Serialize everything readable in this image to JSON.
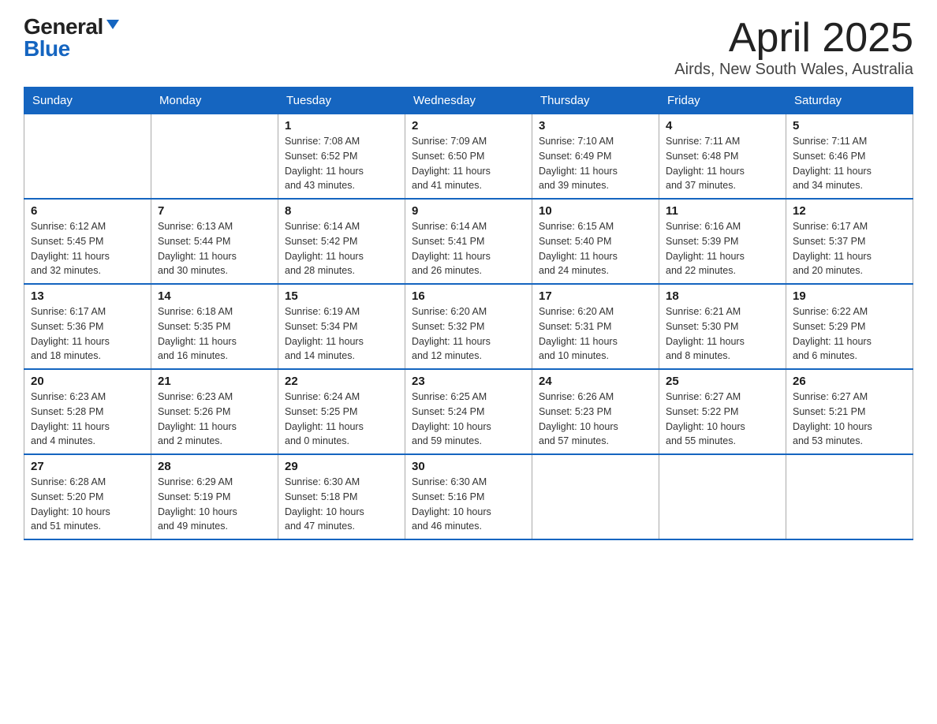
{
  "logo": {
    "general": "General",
    "blue": "Blue"
  },
  "title": "April 2025",
  "subtitle": "Airds, New South Wales, Australia",
  "weekdays": [
    "Sunday",
    "Monday",
    "Tuesday",
    "Wednesday",
    "Thursday",
    "Friday",
    "Saturday"
  ],
  "weeks": [
    [
      {
        "day": "",
        "info": ""
      },
      {
        "day": "",
        "info": ""
      },
      {
        "day": "1",
        "info": "Sunrise: 7:08 AM\nSunset: 6:52 PM\nDaylight: 11 hours\nand 43 minutes."
      },
      {
        "day": "2",
        "info": "Sunrise: 7:09 AM\nSunset: 6:50 PM\nDaylight: 11 hours\nand 41 minutes."
      },
      {
        "day": "3",
        "info": "Sunrise: 7:10 AM\nSunset: 6:49 PM\nDaylight: 11 hours\nand 39 minutes."
      },
      {
        "day": "4",
        "info": "Sunrise: 7:11 AM\nSunset: 6:48 PM\nDaylight: 11 hours\nand 37 minutes."
      },
      {
        "day": "5",
        "info": "Sunrise: 7:11 AM\nSunset: 6:46 PM\nDaylight: 11 hours\nand 34 minutes."
      }
    ],
    [
      {
        "day": "6",
        "info": "Sunrise: 6:12 AM\nSunset: 5:45 PM\nDaylight: 11 hours\nand 32 minutes."
      },
      {
        "day": "7",
        "info": "Sunrise: 6:13 AM\nSunset: 5:44 PM\nDaylight: 11 hours\nand 30 minutes."
      },
      {
        "day": "8",
        "info": "Sunrise: 6:14 AM\nSunset: 5:42 PM\nDaylight: 11 hours\nand 28 minutes."
      },
      {
        "day": "9",
        "info": "Sunrise: 6:14 AM\nSunset: 5:41 PM\nDaylight: 11 hours\nand 26 minutes."
      },
      {
        "day": "10",
        "info": "Sunrise: 6:15 AM\nSunset: 5:40 PM\nDaylight: 11 hours\nand 24 minutes."
      },
      {
        "day": "11",
        "info": "Sunrise: 6:16 AM\nSunset: 5:39 PM\nDaylight: 11 hours\nand 22 minutes."
      },
      {
        "day": "12",
        "info": "Sunrise: 6:17 AM\nSunset: 5:37 PM\nDaylight: 11 hours\nand 20 minutes."
      }
    ],
    [
      {
        "day": "13",
        "info": "Sunrise: 6:17 AM\nSunset: 5:36 PM\nDaylight: 11 hours\nand 18 minutes."
      },
      {
        "day": "14",
        "info": "Sunrise: 6:18 AM\nSunset: 5:35 PM\nDaylight: 11 hours\nand 16 minutes."
      },
      {
        "day": "15",
        "info": "Sunrise: 6:19 AM\nSunset: 5:34 PM\nDaylight: 11 hours\nand 14 minutes."
      },
      {
        "day": "16",
        "info": "Sunrise: 6:20 AM\nSunset: 5:32 PM\nDaylight: 11 hours\nand 12 minutes."
      },
      {
        "day": "17",
        "info": "Sunrise: 6:20 AM\nSunset: 5:31 PM\nDaylight: 11 hours\nand 10 minutes."
      },
      {
        "day": "18",
        "info": "Sunrise: 6:21 AM\nSunset: 5:30 PM\nDaylight: 11 hours\nand 8 minutes."
      },
      {
        "day": "19",
        "info": "Sunrise: 6:22 AM\nSunset: 5:29 PM\nDaylight: 11 hours\nand 6 minutes."
      }
    ],
    [
      {
        "day": "20",
        "info": "Sunrise: 6:23 AM\nSunset: 5:28 PM\nDaylight: 11 hours\nand 4 minutes."
      },
      {
        "day": "21",
        "info": "Sunrise: 6:23 AM\nSunset: 5:26 PM\nDaylight: 11 hours\nand 2 minutes."
      },
      {
        "day": "22",
        "info": "Sunrise: 6:24 AM\nSunset: 5:25 PM\nDaylight: 11 hours\nand 0 minutes."
      },
      {
        "day": "23",
        "info": "Sunrise: 6:25 AM\nSunset: 5:24 PM\nDaylight: 10 hours\nand 59 minutes."
      },
      {
        "day": "24",
        "info": "Sunrise: 6:26 AM\nSunset: 5:23 PM\nDaylight: 10 hours\nand 57 minutes."
      },
      {
        "day": "25",
        "info": "Sunrise: 6:27 AM\nSunset: 5:22 PM\nDaylight: 10 hours\nand 55 minutes."
      },
      {
        "day": "26",
        "info": "Sunrise: 6:27 AM\nSunset: 5:21 PM\nDaylight: 10 hours\nand 53 minutes."
      }
    ],
    [
      {
        "day": "27",
        "info": "Sunrise: 6:28 AM\nSunset: 5:20 PM\nDaylight: 10 hours\nand 51 minutes."
      },
      {
        "day": "28",
        "info": "Sunrise: 6:29 AM\nSunset: 5:19 PM\nDaylight: 10 hours\nand 49 minutes."
      },
      {
        "day": "29",
        "info": "Sunrise: 6:30 AM\nSunset: 5:18 PM\nDaylight: 10 hours\nand 47 minutes."
      },
      {
        "day": "30",
        "info": "Sunrise: 6:30 AM\nSunset: 5:16 PM\nDaylight: 10 hours\nand 46 minutes."
      },
      {
        "day": "",
        "info": ""
      },
      {
        "day": "",
        "info": ""
      },
      {
        "day": "",
        "info": ""
      }
    ]
  ]
}
